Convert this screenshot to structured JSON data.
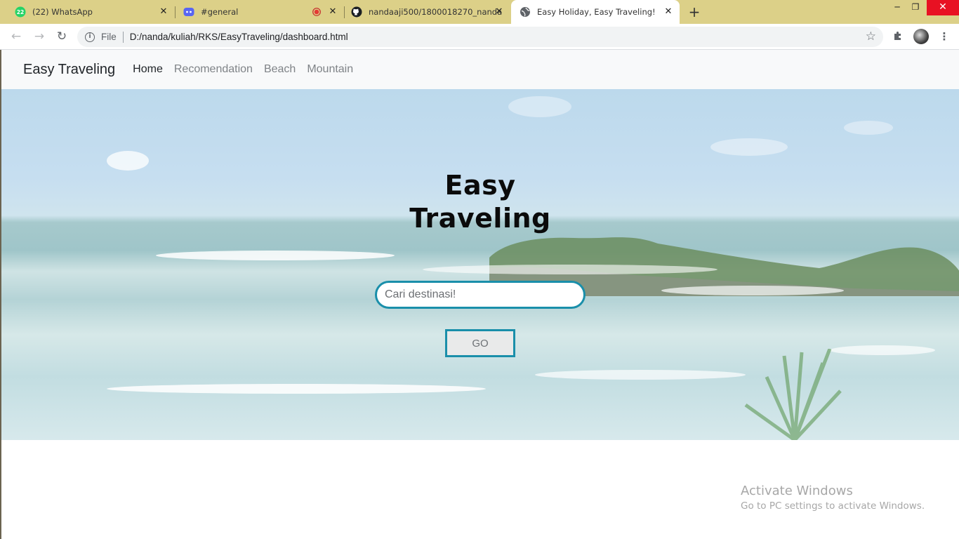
{
  "browser": {
    "tabs": [
      {
        "title": "(22) WhatsApp",
        "badge": "22",
        "icon": "whatsapp-icon",
        "active": false
      },
      {
        "title": "#general",
        "icon": "discord-icon",
        "active": false,
        "recording": true
      },
      {
        "title": "nandaaji500/1800018270_nanda",
        "icon": "github-icon",
        "active": false
      },
      {
        "title": "Easy Holiday, Easy Traveling!",
        "icon": "globe-icon",
        "active": true
      }
    ],
    "address_bar": {
      "scheme_label": "File",
      "url": "D:/nanda/kuliah/RKS/EasyTraveling/dashboard.html"
    }
  },
  "page": {
    "navbar": {
      "brand": "Easy Traveling",
      "links": [
        "Home",
        "Recomendation",
        "Beach",
        "Mountain"
      ]
    },
    "hero": {
      "title_line1": "Easy",
      "title_line2": "Traveling",
      "search_placeholder": "Cari destinasi!",
      "go_label": "GO"
    }
  },
  "watermark": {
    "line1": "Activate Windows",
    "line2": "Go to PC settings to activate Windows."
  },
  "colors": {
    "tab_strip": "#dcd088",
    "accent": "#1a8faa",
    "navbar_bg": "#f8f9fa"
  }
}
